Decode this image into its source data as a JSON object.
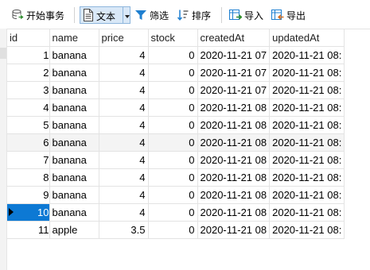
{
  "toolbar": {
    "begin_transaction": "开始事务",
    "text": "文本",
    "filter": "筛选",
    "sort": "排序",
    "import": "导入",
    "export": "导出"
  },
  "colors": {
    "accent": "#0d79d4",
    "selected_text": "#ffffff",
    "alt_row": "#f4f4f4"
  },
  "table": {
    "columns": [
      "id",
      "name",
      "price",
      "stock",
      "createdAt",
      "updatedAt"
    ],
    "rows": [
      [
        "1",
        "banana",
        "4",
        "0",
        "2020-11-21 07",
        "2020-11-21 08:"
      ],
      [
        "2",
        "banana",
        "4",
        "0",
        "2020-11-21 07",
        "2020-11-21 08:"
      ],
      [
        "3",
        "banana",
        "4",
        "0",
        "2020-11-21 07",
        "2020-11-21 08:"
      ],
      [
        "4",
        "banana",
        "4",
        "0",
        "2020-11-21 08",
        "2020-11-21 08:"
      ],
      [
        "5",
        "banana",
        "4",
        "0",
        "2020-11-21 08",
        "2020-11-21 08:"
      ],
      [
        "6",
        "banana",
        "4",
        "0",
        "2020-11-21 08",
        "2020-11-21 08:"
      ],
      [
        "7",
        "banana",
        "4",
        "0",
        "2020-11-21 08",
        "2020-11-21 08:"
      ],
      [
        "8",
        "banana",
        "4",
        "0",
        "2020-11-21 08",
        "2020-11-21 08:"
      ],
      [
        "9",
        "banana",
        "4",
        "0",
        "2020-11-21 08",
        "2020-11-21 08:"
      ],
      [
        "10",
        "banana",
        "4",
        "0",
        "2020-11-21 08",
        "2020-11-21 08:"
      ],
      [
        "11",
        "apple",
        "3.5",
        "0",
        "2020-11-21 08",
        "2020-11-21 08:"
      ]
    ],
    "selected_row": 9,
    "current_row_indicator": "row-10"
  }
}
